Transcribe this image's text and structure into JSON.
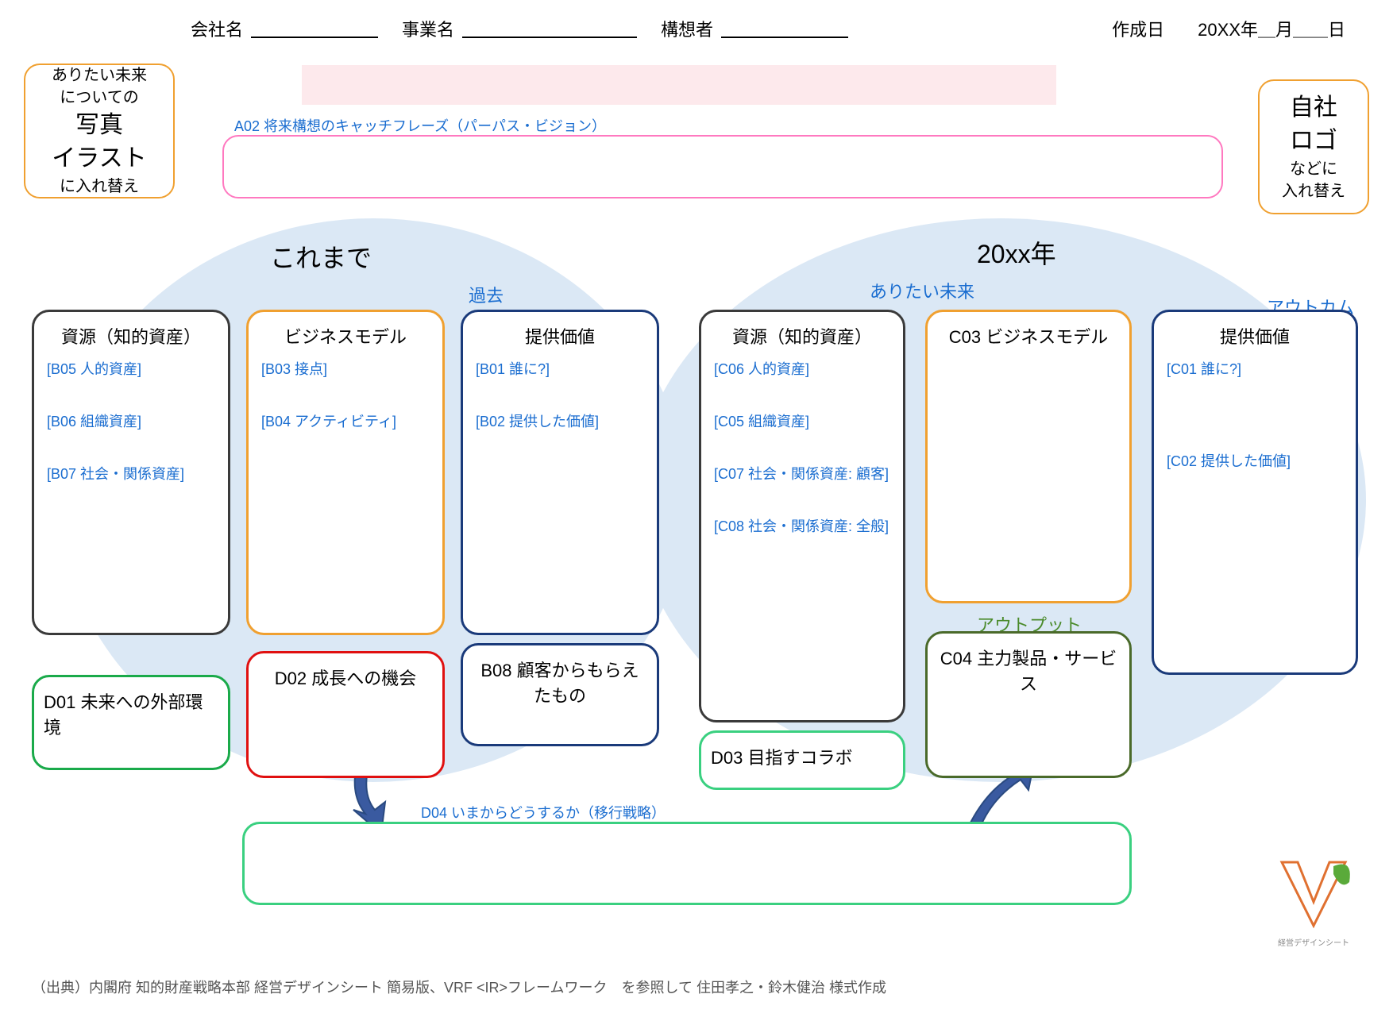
{
  "header": {
    "company_label": "会社名",
    "business_label": "事業名",
    "author_label": "構想者",
    "date_label": "作成日",
    "date_value": "20XX年＿月＿＿日"
  },
  "photo_box": {
    "l1": "ありたい未来",
    "l2": "についての",
    "l3": "写真",
    "l4": "イラスト",
    "l5": "に入れ替え"
  },
  "logo_box": {
    "l1": "自社",
    "l2": "ロゴ",
    "l3": "などに",
    "l4": "入れ替え"
  },
  "a02": {
    "label": "A02 将来構想のキャッチフレーズ（パーパス・ビジョン）"
  },
  "era": {
    "past": "これまで",
    "future": "20xx年"
  },
  "sublabels": {
    "kako": "過去",
    "aritai": "ありたい未来",
    "outcome": "アウトカム",
    "output": "アウトプット"
  },
  "past": {
    "resource": {
      "title": "資源（知的資産）",
      "b05": "[B05 人的資産]",
      "b06": "[B06 組織資産]",
      "b07": "[B07 社会・関係資産]"
    },
    "biz": {
      "title": "ビジネスモデル",
      "b03": "[B03 接点]",
      "b04": "[B04 アクティビティ]"
    },
    "value": {
      "title": "提供価値",
      "b01": "[B01 誰に?]",
      "b02": "[B02 提供した価値]"
    },
    "b08": {
      "title": "B08 顧客からもらえたもの"
    },
    "d01": {
      "title": "D01 未来への外部環境"
    },
    "d02": {
      "title": "D02 成長への機会"
    }
  },
  "future": {
    "resource": {
      "title": "資源（知的資産）",
      "c06": "[C06 人的資産]",
      "c05": "[C05 組織資産]",
      "c07": "[C07 社会・関係資産: 顧客]",
      "c08": "[C08 社会・関係資産: 全般]"
    },
    "biz": {
      "title": "C03 ビジネスモデル"
    },
    "c04": {
      "title": "C04 主力製品・サービス"
    },
    "value": {
      "title": "提供価値",
      "c01": "[C01 誰に?]",
      "c02": "[C02 提供した価値]"
    },
    "d03": {
      "title": "D03 目指すコラボ"
    }
  },
  "d04": {
    "label": "D04 いまからどうするか（移行戦略）"
  },
  "source": "（出典）内閣府 知的財産戦略本部 経営デザインシート 簡易版、VRF <IR>フレームワーク　を参照して 住田孝之・鈴木健治 様式作成",
  "mark_text": "経営デザインシート"
}
